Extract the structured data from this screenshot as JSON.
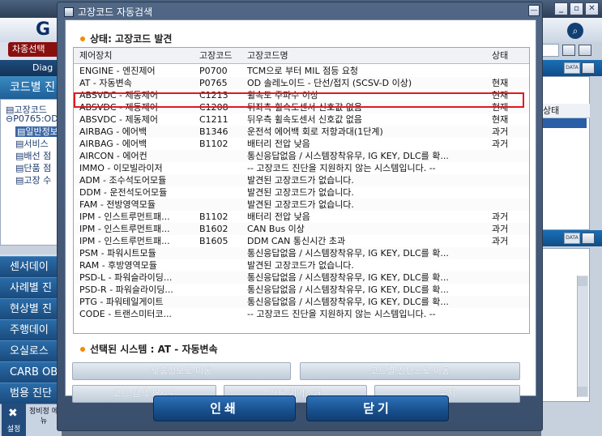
{
  "background": {
    "logo_text": "G",
    "model_button": "차종선택",
    "diag_label": "Diag",
    "code_menu": "코드별 진",
    "tree": [
      "고장코드",
      "P0765:OD",
      "일반정보",
      "서비스",
      "배선 점",
      "단품 점",
      "고장 수"
    ],
    "left_menu": [
      "센서데이",
      "사례별 진",
      "현상별 진",
      "주행데이",
      "오실로스",
      "CARB OB",
      "범용 진단"
    ],
    "setup_label": "설정",
    "maint_label": "정비정 메뉴",
    "status_header": "상태"
  },
  "dialog": {
    "title": "고장코드 자동검색",
    "status": "상태: 고장코드 발견",
    "columns": [
      "제어장치",
      "고장코드",
      "고장코드명",
      "상태"
    ],
    "rows": [
      [
        "ENGINE - 엔진제어",
        "P0700",
        "TCM으로 부터 MIL 점등 요청",
        ""
      ],
      [
        "AT - 자동변속",
        "P0765",
        "OD 솔레노이드 - 단선/접지 (SCSV-D 이상)",
        "현재"
      ],
      [
        "ABSVDC - 제동제어",
        "C1213",
        "휠속도 주파수 이상",
        "현재"
      ],
      [
        "ABSVDC - 제동제어",
        "C1208",
        "뒤좌측 휠속도센서 신호값 없음",
        "현재"
      ],
      [
        "ABSVDC - 제동제어",
        "C1211",
        "뒤우측 휠속도센서 신호값 없음",
        "현재"
      ],
      [
        "AIRBAG - 에어백",
        "B1346",
        "운전석 에어백 회로 저항과대(1단계)",
        "과거"
      ],
      [
        "AIRBAG - 에어백",
        "B1102",
        "배터리 전압 낮음",
        "과거"
      ],
      [
        "AIRCON - 에어컨",
        "",
        "통신응답없음 / 시스템장착유무, IG KEY, DLC를 확...",
        ""
      ],
      [
        "IMMO - 이모빌라이저",
        "",
        "-- 고장코드 진단을 지원하지 않는 시스템입니다. --",
        ""
      ],
      [
        "ADM - 조수석도어모듈",
        "",
        "발견된 고장코드가 없습니다.",
        ""
      ],
      [
        "DDM - 운전석도어모듈",
        "",
        "발견된 고장코드가 없습니다.",
        ""
      ],
      [
        "FAM - 전방영역모듈",
        "",
        "발견된 고장코드가 없습니다.",
        ""
      ],
      [
        "IPM - 인스트루먼트패...",
        "B1102",
        "배터리 전압 낮음",
        "과거"
      ],
      [
        "IPM - 인스트루먼트패...",
        "B1602",
        "CAN Bus 이상",
        "과거"
      ],
      [
        "IPM - 인스트루먼트패...",
        "B1605",
        "DDM CAN 통신시간 초과",
        "과거"
      ],
      [
        "PSM - 파워시트모듈",
        "",
        "통신응답없음 / 시스템장착유무, IG KEY, DLC를 확...",
        ""
      ],
      [
        "RAM - 후방영역모듈",
        "",
        "발견된 고장코드가 없습니다.",
        ""
      ],
      [
        "PSD-L - 파워슬라이딩...",
        "",
        "통신응답없음 / 시스템장착유무, IG KEY, DLC를 확...",
        ""
      ],
      [
        "PSD-R - 파워슬라이딩...",
        "",
        "통신응답없음 / 시스템장착유무, IG KEY, DLC를 확...",
        ""
      ],
      [
        "PTG - 파워테일게이트",
        "",
        "통신응답없음 / 시스템장착유무, IG KEY, DLC를 확...",
        ""
      ],
      [
        "CODE - 트랜스미터코...",
        "",
        "-- 고장코드 진단을 지원하지 않는 시스템입니다. --",
        ""
      ]
    ],
    "selected_system": "선택된 시스템 :  AT - 자동변속",
    "buttons": {
      "match_info": "맞춤정보로 이동",
      "code_diag": "코드별 진단으로 이동",
      "retry": "코드 검색 재시도",
      "clear_all": "전체 기억소거",
      "stop": "중지",
      "print": "인쇄",
      "close": "닫기"
    }
  }
}
